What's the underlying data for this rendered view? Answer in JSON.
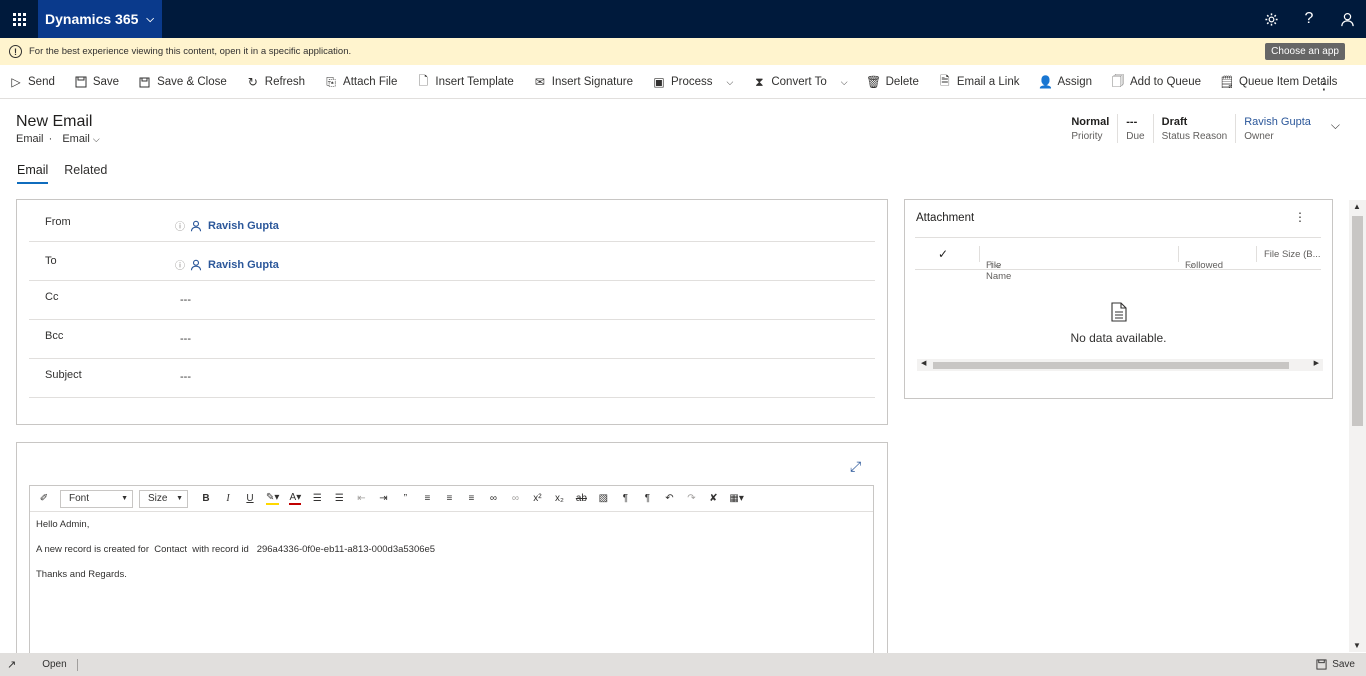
{
  "app": {
    "brand": "Dynamics 365"
  },
  "notice": {
    "message": "For the best experience viewing this content, open it in a specific application.",
    "choose_app": "Choose an app"
  },
  "commands": [
    {
      "label": "Send",
      "icon": "send-icon"
    },
    {
      "label": "Save",
      "icon": "save-icon"
    },
    {
      "label": "Save & Close",
      "icon": "save-close-icon"
    },
    {
      "label": "Refresh",
      "icon": "refresh-icon"
    },
    {
      "label": "Attach File",
      "icon": "paperclip-icon"
    },
    {
      "label": "Insert Template",
      "icon": "template-icon"
    },
    {
      "label": "Insert Signature",
      "icon": "signature-icon"
    },
    {
      "label": "Process",
      "icon": "process-icon"
    },
    {
      "label": "Convert To",
      "icon": "convert-icon"
    },
    {
      "label": "Delete",
      "icon": "trash-icon"
    },
    {
      "label": "Email a Link",
      "icon": "email-link-icon"
    },
    {
      "label": "Assign",
      "icon": "assign-icon"
    },
    {
      "label": "Add to Queue",
      "icon": "queue-icon"
    },
    {
      "label": "Queue Item Details",
      "icon": "queue-details-icon"
    }
  ],
  "header": {
    "title": "New Email",
    "entity": "Email",
    "separator": "·",
    "form": "Email",
    "fields": [
      {
        "value": "Normal",
        "label": "Priority"
      },
      {
        "value": "---",
        "label": "Due"
      },
      {
        "value": "Draft",
        "label": "Status Reason"
      },
      {
        "value": "Ravish Gupta",
        "label": "Owner"
      }
    ]
  },
  "tabs": [
    {
      "label": "Email"
    },
    {
      "label": "Related"
    }
  ],
  "form": {
    "rows": [
      {
        "label": "From",
        "value": "Ravish Gupta"
      },
      {
        "label": "To",
        "value": "Ravish Gupta"
      },
      {
        "label": "Cc",
        "value": "---"
      },
      {
        "label": "Bcc",
        "value": "---"
      },
      {
        "label": "Subject",
        "value": "---"
      }
    ]
  },
  "attachment": {
    "title": "Attachment",
    "columns": [
      "File Name",
      "Followed",
      "File Size (B..."
    ],
    "empty": "No data available."
  },
  "editor": {
    "font_label": "Font",
    "size_label": "Size",
    "lines": [
      "Hello Admin,",
      "A new record is created for  Contact  with record id   296a4336-0f0e-eb11-a813-000d3a5306e5",
      "Thanks and Regards."
    ]
  },
  "status": {
    "state": "Open",
    "save": "Save"
  }
}
